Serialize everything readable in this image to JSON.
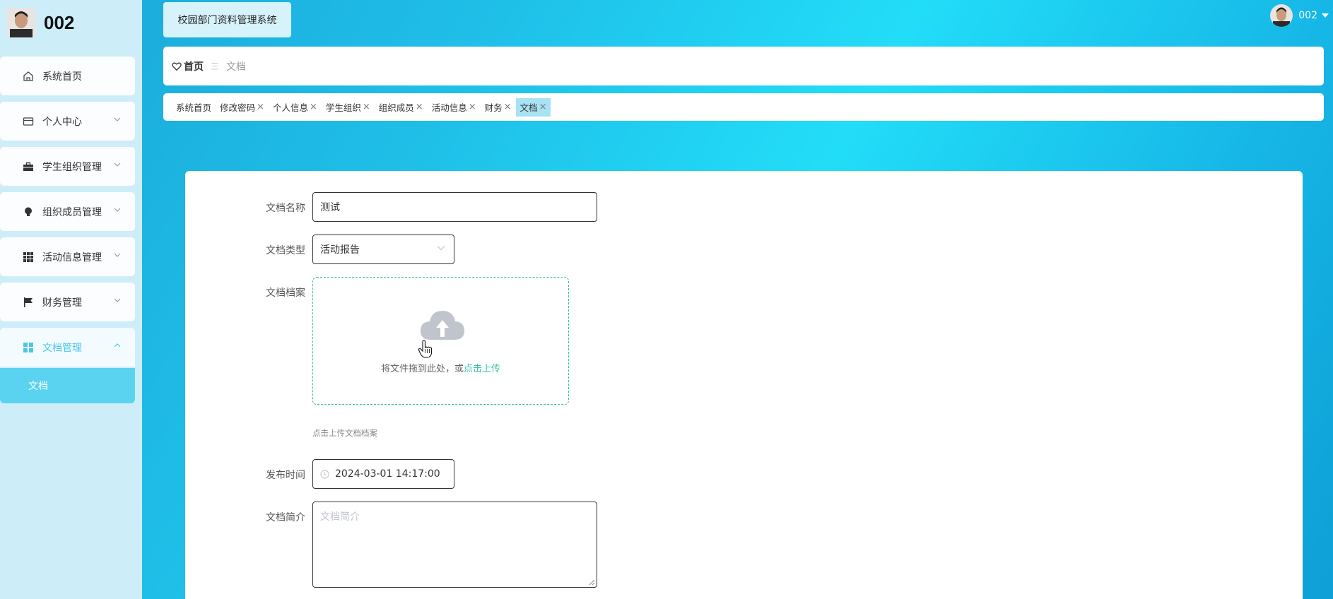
{
  "sidebar": {
    "user_name": "002",
    "items": [
      {
        "label": "系统首页",
        "icon": "home-icon"
      },
      {
        "label": "个人中心",
        "icon": "wallet-icon"
      },
      {
        "label": "学生组织管理",
        "icon": "briefcase-icon"
      },
      {
        "label": "组织成员管理",
        "icon": "bulb-icon"
      },
      {
        "label": "活动信息管理",
        "icon": "grid-icon"
      },
      {
        "label": "财务管理",
        "icon": "flag-icon"
      },
      {
        "label": "文档管理",
        "icon": "apps-icon"
      }
    ],
    "sub_items": [
      {
        "label": "文档"
      }
    ]
  },
  "header": {
    "system_title": "校园部门资料管理系统",
    "user_name": "002"
  },
  "breadcrumb": {
    "home": "首页",
    "separator": "三",
    "current": "文档"
  },
  "tabs": [
    {
      "label": "系统首页",
      "closable": false
    },
    {
      "label": "修改密码",
      "closable": true
    },
    {
      "label": "个人信息",
      "closable": true
    },
    {
      "label": "学生组织",
      "closable": true
    },
    {
      "label": "组织成员",
      "closable": true
    },
    {
      "label": "活动信息",
      "closable": true
    },
    {
      "label": "财务",
      "closable": true
    },
    {
      "label": "文档",
      "closable": true,
      "active": true
    }
  ],
  "form": {
    "name_label": "文档名称",
    "name_value": "测试",
    "type_label": "文档类型",
    "type_value": "活动报告",
    "file_label": "文档档案",
    "upload_text": "将文件拖到此处，或",
    "upload_link": "点击上传",
    "upload_hint": "点击上传文档档案",
    "time_label": "发布时间",
    "time_value": "2024-03-01 14:17:00",
    "intro_label": "文档简介",
    "intro_placeholder": "文档简介"
  },
  "colors": {
    "accent": "#49c6ea",
    "active_submenu": "#5ad3f0",
    "upload_link": "#2fc0a2"
  }
}
